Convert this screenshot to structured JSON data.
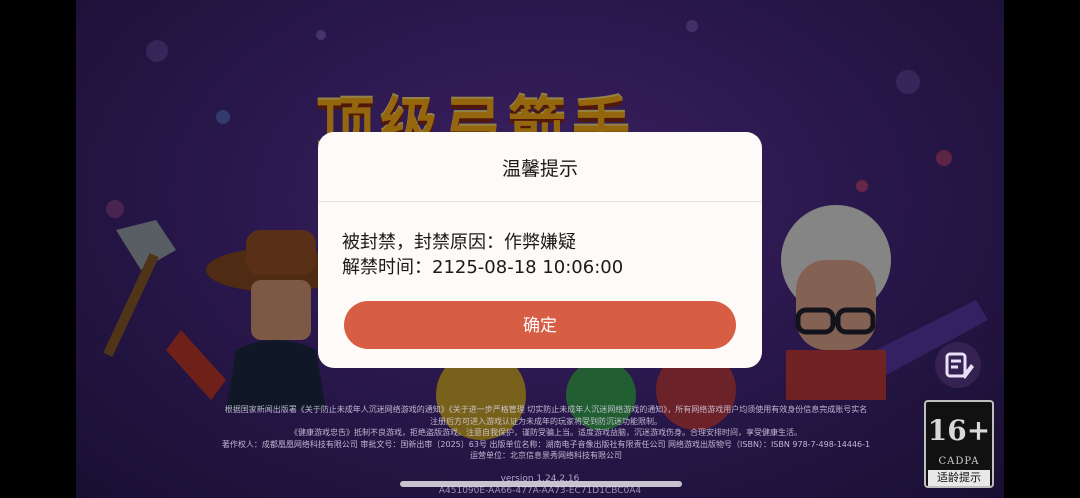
{
  "game": {
    "title_text": "顶级弓箭手"
  },
  "dialog": {
    "title": "温馨提示",
    "line1": "被封禁，封禁原因：作弊嫌疑",
    "line2": "解禁时间：2125-08-18 10:06:00",
    "confirm_label": "确定"
  },
  "notice": {
    "line1": "根据国家新闻出版署《关于防止未成年人沉迷网络游戏的通知》《关于进一步严格管理 切实防止未成年人沉迷网络游戏的通知》，所有网络游戏用户均须使用有效身份信息完成账号实名",
    "line2": "注册后方可进入游戏认证为未成年的玩家将受到防沉迷功能限制。",
    "line3": "《健康游戏忠告》抵制不良游戏，拒绝盗版游戏。注意自我保护，谨防受骗上当。适度游戏益脑，沉迷游戏伤身。合理安排时间，享受健康生活。",
    "line4": "著作权人：成都凰凰网络科技有限公司  审批文号：国新出审〔2025〕63号  出版单位名称：湖南电子音像出版社有限责任公司  网络游戏出版物号（ISBN）：ISBN 978-7-498-14446-1",
    "line5": "运营单位：北京信息景秀网络科技有限公司"
  },
  "version": "version 1.24.2.16",
  "build": "A451090E-AA66-477A-AA73-EC71D1CBC0A4",
  "age_rating": {
    "number": "16+",
    "org": "CADPA",
    "caption": "适龄提示"
  },
  "colors": {
    "confirm_button": "#d75d44",
    "dialog_bg": "#fdfaf7",
    "background": "#4a2a86"
  },
  "icons": {
    "edit": "edit-icon"
  }
}
